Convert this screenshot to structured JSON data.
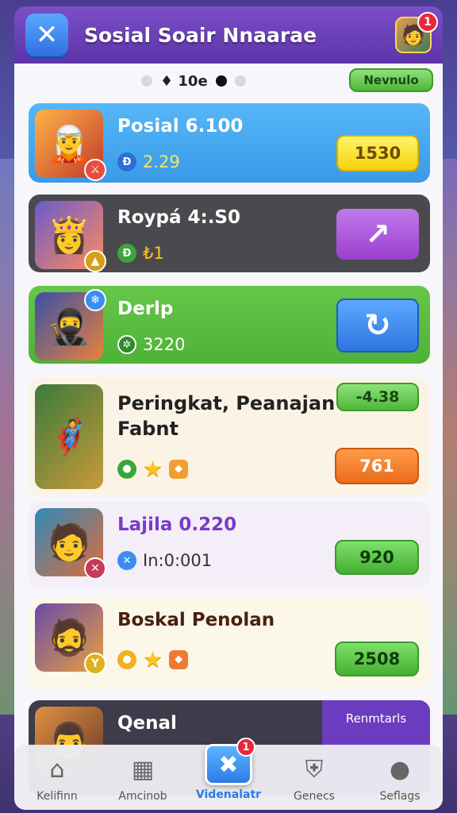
{
  "header": {
    "title": "Sosial Soair Nnaarae",
    "close_icon": "close-icon",
    "notification_count": "1"
  },
  "pager": {
    "label": "♦ 10e",
    "new_button": "Nevnulo"
  },
  "cards": [
    {
      "name": "Posial 6.100",
      "stat_icon_1": "Đ",
      "stat_1": "2.29",
      "action": "1530",
      "action_color": "#ffe132"
    },
    {
      "name": "Roypá 4:.S0",
      "stat_icon_1": "Đ",
      "stat_1": "₺1",
      "action_icon": "arrow-up-right-icon",
      "action_color": "#a64fd8"
    },
    {
      "name": "Derlp",
      "stat_icon_1": "✲",
      "stat_1": "3220",
      "action_icon": "refresh-icon",
      "action_color": "#3b8ef0"
    },
    {
      "name": "Peringkat, Peanajan Fabnt",
      "top_action": "-4.38",
      "action": "761",
      "action_color": "#f07f2c"
    },
    {
      "name": "Lajila 0.220",
      "stat_1": "In:0:001",
      "action": "920",
      "action_color": "#5bc94a"
    },
    {
      "name": "Boskal Penolan",
      "action": "2508",
      "action_color": "#5bc94a"
    },
    {
      "name": "Qenal",
      "side_label": "Renmtarls"
    }
  ],
  "nav": [
    {
      "label": "Kelifinn",
      "icon": "home-icon"
    },
    {
      "label": "Amcinob",
      "icon": "building-icon"
    },
    {
      "label": "Videnalatr",
      "icon": "video-icon",
      "badge": "1"
    },
    {
      "label": "Genecs",
      "icon": "shield-icon"
    },
    {
      "label": "Seflags",
      "icon": "profile-icon"
    }
  ]
}
